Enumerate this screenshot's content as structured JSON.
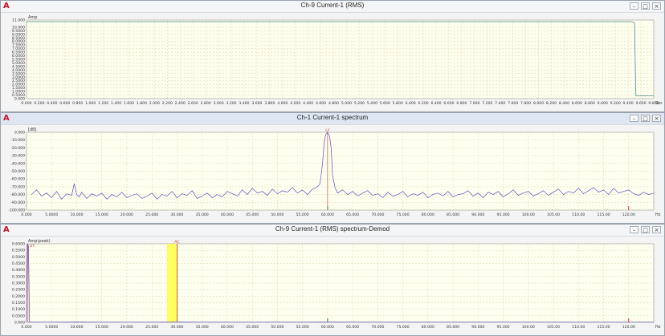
{
  "icons": {
    "app_glyph": "A",
    "minimize": "–",
    "restore": "□",
    "close": "×"
  },
  "colors": {
    "plot_bg": "#fffff0",
    "grid": "#d9d6a8",
    "trace": "#5b4fbf",
    "trace_rms": "#4a8a98",
    "cursor_red": "#d03030",
    "cursor_green": "#2f8a3a",
    "highlight": "#ffff50"
  },
  "panels": [
    {
      "title": "Ch-9 Current-1 (RMS)",
      "ylabel": "Amp",
      "xunit": "Sec",
      "active": false,
      "chart_data": {
        "type": "line",
        "xlim": [
          0,
          9.8
        ],
        "ylim": [
          0,
          11
        ],
        "yticks": [
          "11.000",
          "10.000",
          "9.5000",
          "9.0000",
          "8.5000",
          "8.0000",
          "7.5000",
          "7.0000",
          "6.5000",
          "6.0000",
          "5.5000",
          "5.0000",
          "4.5000",
          "4.0000",
          "3.5000",
          "3.0000",
          "2.5000",
          "2.0000",
          "1.5000",
          "1.0000",
          "0.5000",
          "0.000"
        ],
        "ytick_values": [
          11,
          10,
          9.5,
          9,
          8.5,
          8,
          7.5,
          7,
          6.5,
          6,
          5.5,
          5,
          4.5,
          4,
          3.5,
          3,
          2.5,
          2,
          1.5,
          1,
          0.5,
          0
        ],
        "xticks": [
          "0.000",
          "0.200",
          "0.400",
          "0.600",
          "0.800",
          "1.000",
          "1.200",
          "1.400",
          "1.600",
          "1.800",
          "2.000",
          "2.200",
          "2.400",
          "2.600",
          "2.800",
          "3.000",
          "3.200",
          "3.400",
          "3.600",
          "3.800",
          "4.000",
          "4.200",
          "4.400",
          "4.600",
          "4.800",
          "5.000",
          "5.200",
          "5.400",
          "5.600",
          "5.800",
          "6.000",
          "6.200",
          "6.400",
          "6.600",
          "6.800",
          "7.000",
          "7.200",
          "7.400",
          "7.600",
          "7.800",
          "8.000",
          "8.200",
          "8.400",
          "8.600",
          "8.800",
          "9.000",
          "9.200",
          "9.400",
          "9.600",
          "9.800"
        ],
        "series": [
          {
            "x": [
              0,
              0.5,
              1,
              2,
              3,
              4,
              5,
              6,
              7,
              8,
              9,
              9.45,
              9.5,
              9.52,
              9.8
            ],
            "y": [
              10.78,
              10.77,
              10.78,
              10.77,
              10.78,
              10.77,
              10.78,
              10.77,
              10.78,
              10.77,
              10.78,
              10.77,
              10.6,
              0.4,
              0.4
            ]
          }
        ]
      }
    },
    {
      "title": "Ch-1 Current-1 spectrum",
      "ylabel": "[dB]",
      "xunit": "Hz",
      "active": true,
      "marker": {
        "label": "LF",
        "x": 60
      },
      "chart_data": {
        "type": "line",
        "xlim": [
          0,
          125
        ],
        "ylim": [
          -100,
          0
        ],
        "yticks": [
          "0.000",
          "-10.000",
          "-20.000",
          "-30.000",
          "-40.000",
          "-50.000",
          "-60.000",
          "-70.000",
          "-80.000",
          "-90.000",
          "-100.000"
        ],
        "ytick_values": [
          0,
          -10,
          -20,
          -30,
          -40,
          -50,
          -60,
          -70,
          -80,
          -90,
          -100
        ],
        "xticks": [
          "0.000",
          "5.0000",
          "10.000",
          "15.000",
          "20.000",
          "25.000",
          "30.000",
          "35.000",
          "40.000",
          "45.000",
          "50.000",
          "55.000",
          "60.000",
          "65.000",
          "70.000",
          "75.000",
          "80.000",
          "85.000",
          "90.000",
          "95.000",
          "100.00",
          "105.00",
          "110.00",
          "115.00",
          "120.00"
        ],
        "xtick_values": [
          0,
          5,
          10,
          15,
          20,
          25,
          30,
          35,
          40,
          45,
          50,
          55,
          60,
          65,
          70,
          75,
          80,
          85,
          90,
          95,
          100,
          105,
          110,
          115,
          120
        ],
        "series": [
          {
            "x": [
              1,
              2,
              3,
              4,
              5,
              6,
              7,
              8,
              9,
              9.5,
              10,
              10.5,
              11,
              12,
              13,
              14,
              15,
              16,
              17,
              18,
              19,
              20,
              21,
              22,
              23,
              24,
              25,
              26,
              27,
              28,
              29,
              30,
              31,
              32,
              33,
              34,
              35,
              36,
              37,
              38,
              39,
              40,
              41,
              42,
              43,
              44,
              45,
              46,
              47,
              48,
              49,
              50,
              51,
              52,
              53,
              54,
              55,
              56,
              57,
              58,
              58.5,
              59,
              59.3,
              59.6,
              60,
              60.4,
              60.7,
              61,
              61.5,
              62,
              63,
              64,
              65,
              66,
              67,
              68,
              69,
              70,
              71,
              72,
              73,
              74,
              75,
              76,
              77,
              78,
              79,
              80,
              81,
              82,
              83,
              84,
              85,
              86,
              87,
              88,
              89,
              90,
              91,
              92,
              93,
              94,
              95,
              96,
              97,
              98,
              99,
              100,
              101,
              102,
              103,
              104,
              105,
              106,
              107,
              108,
              109,
              110,
              111,
              112,
              113,
              114,
              115,
              116,
              117,
              118,
              119,
              120,
              121,
              122,
              123,
              124,
              125
            ],
            "y": [
              -80,
              -74,
              -82,
              -78,
              -84,
              -76,
              -86,
              -79,
              -81,
              -66,
              -80,
              -83,
              -77,
              -85,
              -79,
              -82,
              -78,
              -86,
              -80,
              -83,
              -77,
              -84,
              -81,
              -79,
              -85,
              -82,
              -78,
              -86,
              -80,
              -82,
              -76,
              -84,
              -79,
              -81,
              -75,
              -85,
              -82,
              -78,
              -84,
              -80,
              -83,
              -76,
              -79,
              -82,
              -74,
              -80,
              -72,
              -78,
              -76,
              -81,
              -73,
              -79,
              -75,
              -77,
              -71,
              -78,
              -74,
              -80,
              -73,
              -70,
              -66,
              -40,
              -15,
              -3,
              0,
              -5,
              -20,
              -55,
              -72,
              -78,
              -74,
              -80,
              -76,
              -82,
              -78,
              -75,
              -81,
              -79,
              -84,
              -77,
              -82,
              -80,
              -76,
              -83,
              -79,
              -81,
              -77,
              -84,
              -80,
              -78,
              -82,
              -76,
              -83,
              -80,
              -79,
              -75,
              -82,
              -78,
              -84,
              -77,
              -80,
              -76,
              -83,
              -79,
              -74,
              -81,
              -78,
              -76,
              -82,
              -79,
              -75,
              -81,
              -77,
              -73,
              -80,
              -76,
              -78,
              -72,
              -79,
              -75,
              -71,
              -77,
              -74,
              -80,
              -72,
              -78,
              -76,
              -74,
              -79,
              -81,
              -77,
              -80,
              -78,
              -79,
              -78
            ]
          }
        ]
      }
    },
    {
      "title": "Ch-9 Current-1 (RMS) spectrum-Demod",
      "ylabel": "Amp(peak)",
      "xunit": "Hz",
      "active": false,
      "marker_left": {
        "label": "HY",
        "x": 0.3
      },
      "marker_band": {
        "label": "AC",
        "x_from": 28,
        "x_to": 30
      },
      "chart_data": {
        "type": "line",
        "xlim": [
          0,
          125
        ],
        "ylim": [
          0,
          0.6
        ],
        "yticks": [
          "0.6000",
          "0.5500",
          "0.5000",
          "0.4500",
          "0.4000",
          "0.3500",
          "0.3000",
          "0.2500",
          "0.2000",
          "0.1500",
          "0.1000",
          "0.0500",
          "0.000"
        ],
        "ytick_values": [
          0.6,
          0.55,
          0.5,
          0.45,
          0.4,
          0.35,
          0.3,
          0.25,
          0.2,
          0.15,
          0.1,
          0.05,
          0
        ],
        "xticks": [
          "0.000",
          "5.0000",
          "10.000",
          "15.000",
          "20.000",
          "25.000",
          "30.000",
          "35.000",
          "40.000",
          "45.000",
          "50.000",
          "55.000",
          "60.000",
          "65.000",
          "70.000",
          "75.000",
          "80.000",
          "85.000",
          "90.000",
          "95.000",
          "100.00",
          "105.00",
          "110.00",
          "115.00",
          "120.00"
        ],
        "xtick_values": [
          0,
          5,
          10,
          15,
          20,
          25,
          30,
          35,
          40,
          45,
          50,
          55,
          60,
          65,
          70,
          75,
          80,
          85,
          90,
          95,
          100,
          105,
          110,
          115,
          120
        ],
        "series": [
          {
            "x": [
              0,
              0.2,
              0.4,
              0.6,
              1,
              5,
              10,
              15,
              20,
              25,
              30,
              35,
              40,
              45,
              50,
              55,
              60,
              65,
              70,
              75,
              80,
              85,
              90,
              95,
              100,
              105,
              110,
              115,
              120,
              125
            ],
            "y": [
              0,
              0.6,
              0.58,
              0.003,
              0.002,
              0.002,
              0.003,
              0.002,
              0.002,
              0.002,
              0.003,
              0.002,
              0.002,
              0.002,
              0.002,
              0.002,
              0.003,
              0.002,
              0.002,
              0.002,
              0.002,
              0.002,
              0.002,
              0.002,
              0.002,
              0.002,
              0.002,
              0.002,
              0.002,
              0.002
            ]
          }
        ]
      }
    }
  ]
}
